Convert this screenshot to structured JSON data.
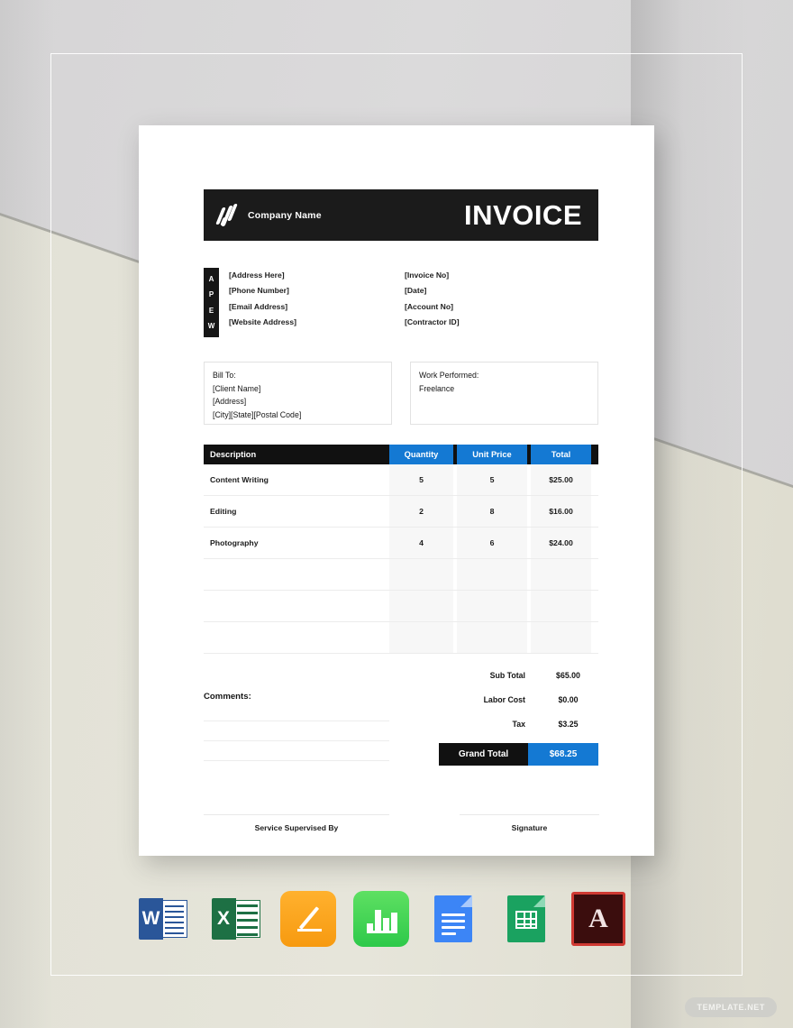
{
  "header": {
    "company_name": "Company Name",
    "title": "INVOICE",
    "logo_icon": "diagonal-stripes-logo-icon"
  },
  "contact": {
    "labels": [
      "A",
      "P",
      "E",
      "W"
    ],
    "values": [
      "[Address Here]",
      "[Phone Number]",
      "[Email Address]",
      "[Website Address]"
    ]
  },
  "invoice_meta": {
    "lines": [
      "[Invoice No]",
      "[Date]",
      "[Account No]",
      "[Contractor ID]"
    ]
  },
  "bill_to": {
    "heading": "Bill To:",
    "lines": [
      "[Client Name]",
      "[Address]",
      "[City][State][Postal Code]"
    ]
  },
  "work_performed": {
    "heading": "Work Performed:",
    "lines": [
      "Freelance"
    ]
  },
  "table": {
    "headers": {
      "description": "Description",
      "quantity": "Quantity",
      "unit_price": "Unit Price",
      "total": "Total"
    },
    "rows": [
      {
        "description": "Content Writing",
        "quantity": "5",
        "unit_price": "5",
        "total": "$25.00"
      },
      {
        "description": "Editing",
        "quantity": "2",
        "unit_price": "8",
        "total": "$16.00"
      },
      {
        "description": "Photography",
        "quantity": "4",
        "unit_price": "6",
        "total": "$24.00"
      },
      {
        "description": "",
        "quantity": "",
        "unit_price": "",
        "total": ""
      },
      {
        "description": "",
        "quantity": "",
        "unit_price": "",
        "total": ""
      },
      {
        "description": "",
        "quantity": "",
        "unit_price": "",
        "total": ""
      }
    ]
  },
  "comments": {
    "label": "Comments:"
  },
  "totals": {
    "sub_total_label": "Sub Total",
    "sub_total_value": "$65.00",
    "labor_cost_label": "Labor Cost",
    "labor_cost_value": "$0.00",
    "tax_label": "Tax",
    "tax_value": "$3.25",
    "grand_total_label": "Grand Total",
    "grand_total_value": "$68.25"
  },
  "signatures": {
    "supervised_by": "Service Supervised By",
    "signature": "Signature"
  },
  "file_formats": [
    {
      "name": "microsoft-word-icon",
      "letter": "W"
    },
    {
      "name": "microsoft-excel-icon",
      "letter": "X"
    },
    {
      "name": "apple-pages-icon",
      "letter": ""
    },
    {
      "name": "apple-numbers-icon",
      "letter": ""
    },
    {
      "name": "google-docs-icon",
      "letter": ""
    },
    {
      "name": "google-sheets-icon",
      "letter": ""
    },
    {
      "name": "adobe-pdf-icon",
      "letter": "A"
    }
  ],
  "watermark": {
    "text": "TEMPLATE.NET"
  },
  "colors": {
    "accent_blue": "#1479d3",
    "dark": "#111111",
    "paper": "#ffffff"
  }
}
